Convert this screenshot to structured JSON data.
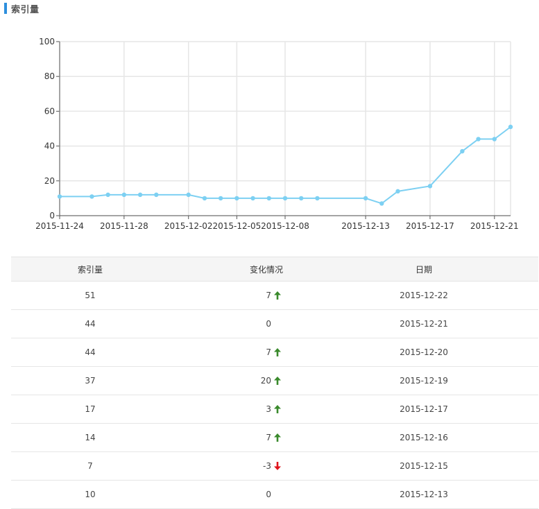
{
  "header": {
    "title": "索引量"
  },
  "colors": {
    "line": "#7dd0f2",
    "up": "#3a8a2c",
    "down": "#e0141c",
    "accent": "#2d8fdd"
  },
  "chart_data": {
    "type": "line",
    "x": [
      "2015-11-24",
      "2015-11-26",
      "2015-11-27",
      "2015-11-28",
      "2015-11-29",
      "2015-11-30",
      "2015-12-02",
      "2015-12-03",
      "2015-12-04",
      "2015-12-05",
      "2015-12-06",
      "2015-12-07",
      "2015-12-08",
      "2015-12-09",
      "2015-12-10",
      "2015-12-13",
      "2015-12-14",
      "2015-12-15",
      "2015-12-17",
      "2015-12-19",
      "2015-12-20",
      "2015-12-21",
      "2015-12-22"
    ],
    "values": [
      11,
      11,
      12,
      12,
      12,
      12,
      12,
      10,
      10,
      10,
      10,
      10,
      10,
      10,
      10,
      10,
      7,
      14,
      17,
      37,
      44,
      44,
      51
    ],
    "x_tick_labels": [
      "2015-11-24",
      "2015-11-28",
      "2015-12-02",
      "2015-12-05",
      "2015-12-08",
      "2015-12-13",
      "2015-12-17",
      "2015-12-21"
    ],
    "y_ticks": [
      0,
      20,
      40,
      60,
      80,
      100
    ],
    "ylim": [
      0,
      100
    ],
    "grid": true
  },
  "table": {
    "headers": {
      "index": "索引量",
      "change": "变化情况",
      "date": "日期"
    },
    "rows": [
      {
        "index": "51",
        "change": "7",
        "dir": "up",
        "date": "2015-12-22"
      },
      {
        "index": "44",
        "change": "0",
        "dir": "none",
        "date": "2015-12-21"
      },
      {
        "index": "44",
        "change": "7",
        "dir": "up",
        "date": "2015-12-20"
      },
      {
        "index": "37",
        "change": "20",
        "dir": "up",
        "date": "2015-12-19"
      },
      {
        "index": "17",
        "change": "3",
        "dir": "up",
        "date": "2015-12-17"
      },
      {
        "index": "14",
        "change": "7",
        "dir": "up",
        "date": "2015-12-16"
      },
      {
        "index": "7",
        "change": "-3",
        "dir": "down",
        "date": "2015-12-15"
      },
      {
        "index": "10",
        "change": "0",
        "dir": "none",
        "date": "2015-12-13"
      }
    ]
  }
}
